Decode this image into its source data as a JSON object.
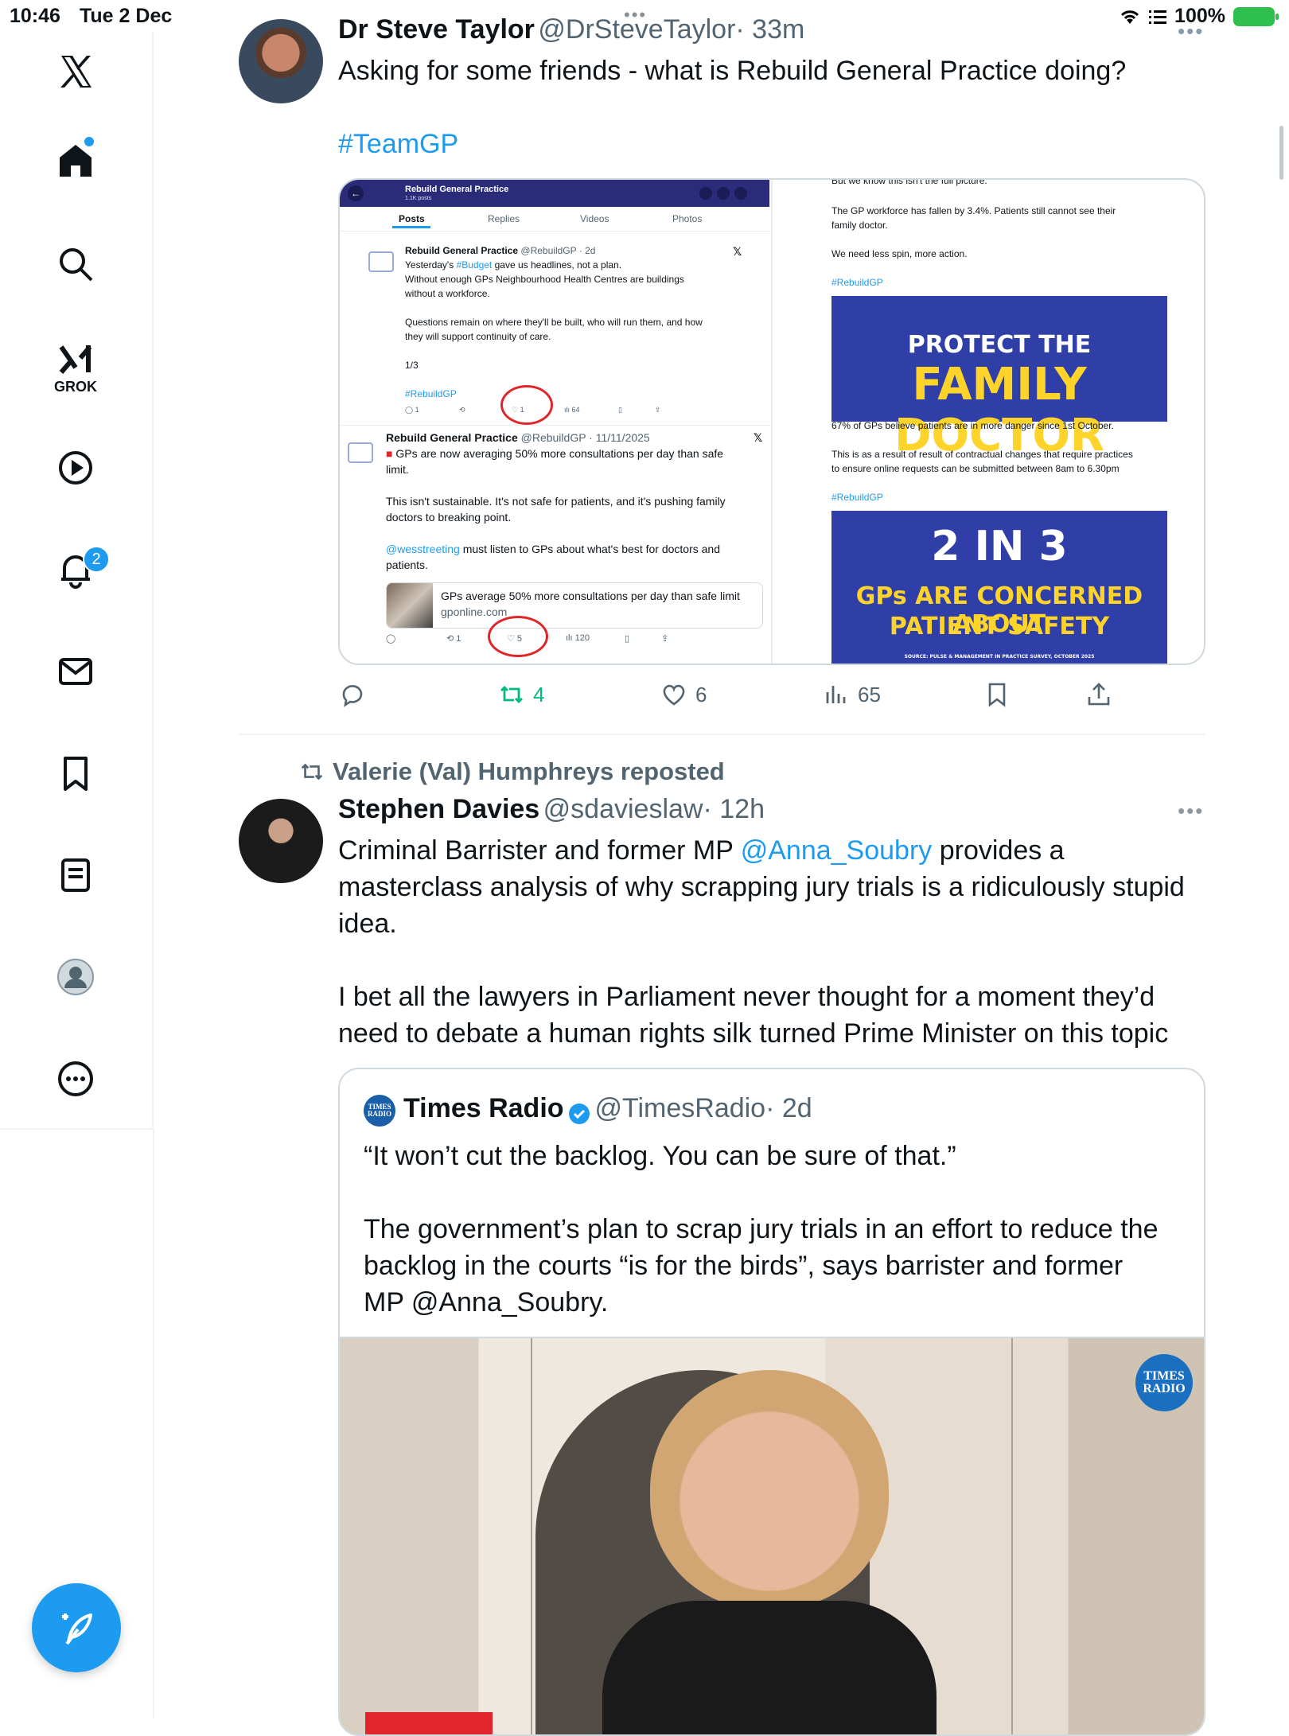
{
  "status_bar": {
    "time": "10:46",
    "date": "Tue 2 Dec",
    "battery": "100%"
  },
  "sidebar": {
    "items": [
      {
        "name": "x-logo-icon"
      },
      {
        "name": "home-icon"
      },
      {
        "name": "search-icon"
      },
      {
        "name": "grok-icon",
        "label": "GROK"
      },
      {
        "name": "video-icon"
      },
      {
        "name": "notifications-icon",
        "badge": "2"
      },
      {
        "name": "messages-icon"
      },
      {
        "name": "bookmarks-icon"
      },
      {
        "name": "lists-icon"
      },
      {
        "name": "profile-icon"
      },
      {
        "name": "more-icon"
      }
    ],
    "compose_icon": "compose-icon"
  },
  "tweet1": {
    "name": "Dr Steve Taylor",
    "handle": "@DrSteveTaylor",
    "time": "· 33m",
    "text": "Asking for some friends - what is Rebuild General Practice doing?",
    "hashtag": "#TeamGP",
    "media": {
      "left": {
        "header_title": "Rebuild General Practice",
        "header_sub": "1.1K posts",
        "tabs": [
          "Posts",
          "Replies",
          "Videos",
          "Photos"
        ],
        "post1": {
          "name": "Rebuild General Practice",
          "handle": "@RebuildGP · 2d",
          "line1_pre": "Yesterday's ",
          "line1_tag": "#Budget",
          "line1_post": " gave us headlines, not a plan.",
          "line2": "Without enough GPs Neighbourhood Health Centres are buildings",
          "line3": "without a workforce.",
          "line4": "Questions remain on where they'll be built, who will run them, and how",
          "line5": "they will support continuity of care.",
          "line6": "1/3",
          "tag": "#RebuildGP",
          "stats": [
            "1",
            "",
            "1",
            "64"
          ]
        },
        "post2": {
          "name": "Rebuild General Practice",
          "handle": "@RebuildGP · 11/11/2025",
          "line1": "GPs are now averaging 50% more consultations per day than safe",
          "line2": "limit.",
          "line3": "This isn't sustainable. It's not safe for patients, and it's pushing family",
          "line4": "doctors to breaking point.",
          "line5_tag": "@wesstreeting",
          "line5_post": " must listen to GPs about what's best for doctors and",
          "line6": "patients.",
          "card_title": "GPs average 50% more consultations per day than safe limit",
          "card_domain": "gponline.com",
          "stats": [
            "",
            "1",
            "5",
            "120"
          ]
        }
      },
      "right": {
        "line1": "But we know this isn't the full picture.",
        "line2": "The GP workforce has fallen by 3.4%. Patients still cannot see their",
        "line3": "family doctor.",
        "line4": "We need less spin, more action.",
        "tag1": "#RebuildGP",
        "poster1_top": "PROTECT THE",
        "poster1_big": "FAMILY DOCTOR",
        "line5": "67% of GPs believe patients are in more danger since 1st October.",
        "line6": "This is as a result of result of contractual changes that require practices",
        "line7": "to ensure online requests can be submitted between 8am to 6.30pm",
        "tag2": "#RebuildGP",
        "poster2_big": "2 IN 3",
        "poster2_line1": "GPs ARE CONCERNED ABOUT",
        "poster2_line2": "PATIENT SAFETY",
        "poster2_source": "SOURCE: PULSE & MANAGEMENT IN PRACTICE SURVEY, OCTOBER 2025"
      }
    },
    "actions": {
      "reposts": "4",
      "likes": "6",
      "views": "65"
    }
  },
  "repost_banner": "Valerie (Val) Humphreys reposted",
  "tweet2": {
    "name": "Stephen Davies",
    "handle": "@sdavieslaw",
    "time": "· 12h",
    "text_pre": "Criminal Barrister and former MP ",
    "mention": "@Anna_Soubry",
    "text_line1_post": " provides a",
    "text_line2": "masterclass analysis of why scrapping jury trials is a ridiculously stupid",
    "text_line3": "idea.",
    "text_line4": "I bet all the lawyers in Parliament never thought for a moment they’d",
    "text_line5": "need to debate a human rights silk turned Prime Minister on this topic",
    "quote": {
      "name": "Times Radio",
      "avatar_text": "TIMES RADIO",
      "handle": "@TimesRadio",
      "time": "· 2d",
      "line1": "“It won’t cut the backlog. You can be sure of that.”",
      "line2": "The government’s plan to scrap jury trials in an effort to reduce the",
      "line3": "backlog in the courts “is for the birds”, says barrister and former",
      "line4": "MP @Anna_Soubry.",
      "logo_line1": "TIMES",
      "logo_line2": "RADIO"
    }
  }
}
